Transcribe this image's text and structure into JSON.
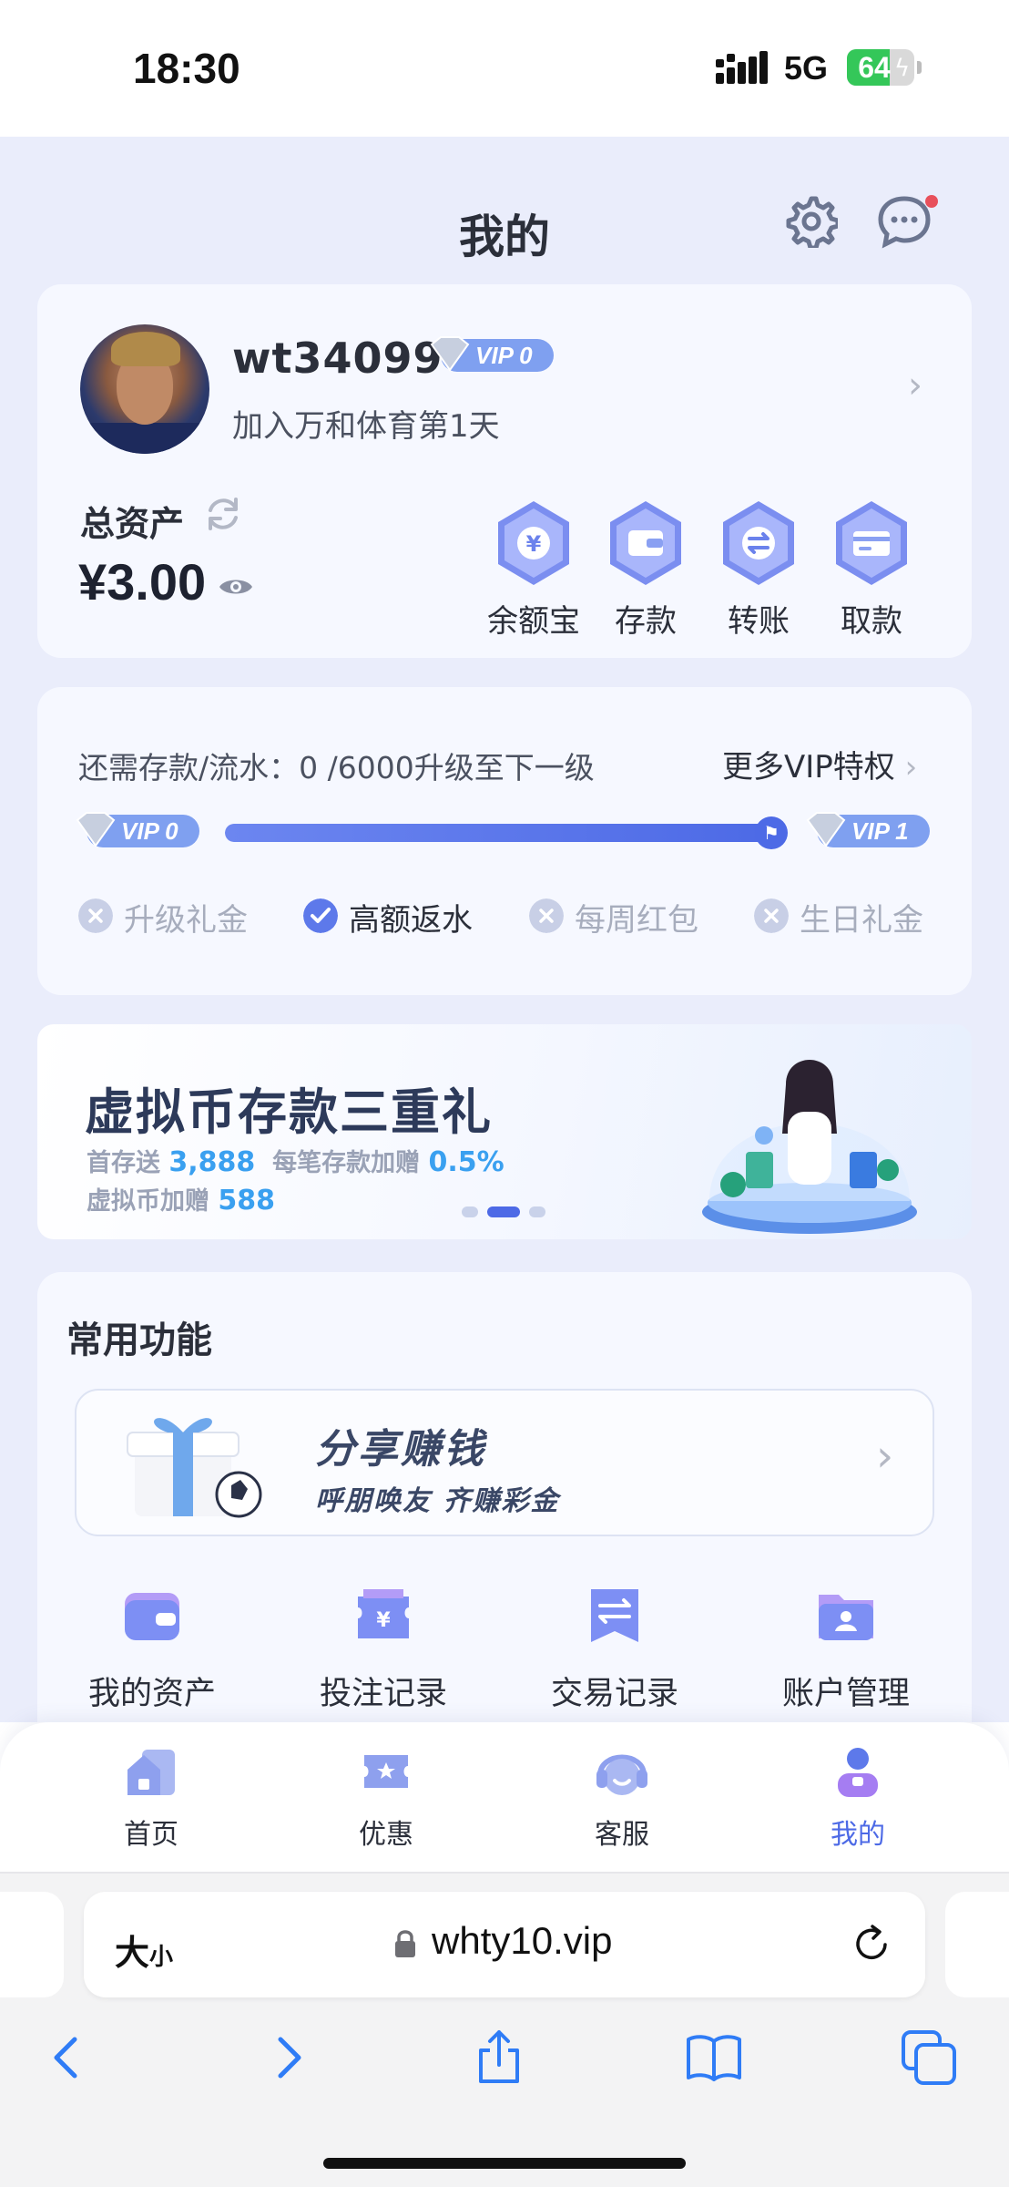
{
  "status_bar": {
    "time": "18:30",
    "network": "5G",
    "battery": "64",
    "battery_level": 0.64
  },
  "header": {
    "title": "我的",
    "settings_icon": "gear-icon",
    "messages_icon": "chat-bubble-icon",
    "has_unread": true
  },
  "profile": {
    "username": "wt34099",
    "vip_level": "VIP 0",
    "joined_text": "加入万和体育第1天",
    "assets_label": "总资产",
    "balance": "¥3.00",
    "actions": [
      {
        "label": "余额宝",
        "icon": "yen-coin-icon"
      },
      {
        "label": "存款",
        "icon": "wallet-icon"
      },
      {
        "label": "转账",
        "icon": "transfer-icon"
      },
      {
        "label": "取款",
        "icon": "card-icon"
      }
    ]
  },
  "vip": {
    "requirement": "还需存款/流水：0 /6000升级至下一级",
    "more_label": "更多VIP特权",
    "current_level": "VIP 0",
    "next_level": "VIP 1",
    "progress": 0.97,
    "perks": [
      {
        "label": "升级礼金",
        "enabled": false
      },
      {
        "label": "高额返水",
        "enabled": true
      },
      {
        "label": "每周红包",
        "enabled": false
      },
      {
        "label": "生日礼金",
        "enabled": false
      }
    ]
  },
  "banner": {
    "title": "虚拟币存款三重礼",
    "line1_a": "首存送",
    "line1_b": "3,888",
    "line1_c": "每笔存款加赠",
    "line1_d": "0.5%",
    "line2_a": "虚拟币加赠",
    "line2_b": "588",
    "slide_count": 3,
    "active_slide": 1
  },
  "functions": {
    "title": "常用功能",
    "share_title": "分享赚钱",
    "share_subtitle": "呼朋唤友 齐赚彩金",
    "items": [
      {
        "label": "我的资产",
        "icon": "wallet-icon"
      },
      {
        "label": "投注记录",
        "icon": "bet-record-icon"
      },
      {
        "label": "交易记录",
        "icon": "transaction-icon"
      },
      {
        "label": "账户管理",
        "icon": "account-folder-icon"
      }
    ]
  },
  "tabbar": {
    "items": [
      {
        "label": "首页",
        "icon": "home-icon",
        "active": false
      },
      {
        "label": "优惠",
        "icon": "ticket-icon",
        "active": false
      },
      {
        "label": "客服",
        "icon": "headset-icon",
        "active": false
      },
      {
        "label": "我的",
        "icon": "person-icon",
        "active": true
      }
    ]
  },
  "browser": {
    "text_size_big": "大",
    "text_size_small": "小",
    "url": "whty10.vip"
  },
  "colors": {
    "accent": "#4d6ae6",
    "page_bg": "#eaedfb",
    "card_bg": "#f6f8ff",
    "highlight_blue": "#3aa0f0",
    "unread_dot": "#e8505b"
  }
}
